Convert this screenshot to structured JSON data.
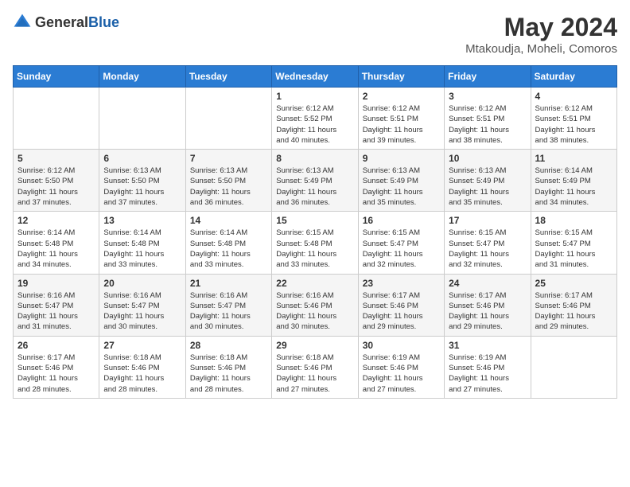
{
  "header": {
    "logo_general": "General",
    "logo_blue": "Blue",
    "month_year": "May 2024",
    "location": "Mtakoudja, Moheli, Comoros"
  },
  "weekdays": [
    "Sunday",
    "Monday",
    "Tuesday",
    "Wednesday",
    "Thursday",
    "Friday",
    "Saturday"
  ],
  "weeks": [
    [
      {
        "day": "",
        "info": ""
      },
      {
        "day": "",
        "info": ""
      },
      {
        "day": "",
        "info": ""
      },
      {
        "day": "1",
        "info": "Sunrise: 6:12 AM\nSunset: 5:52 PM\nDaylight: 11 hours\nand 40 minutes."
      },
      {
        "day": "2",
        "info": "Sunrise: 6:12 AM\nSunset: 5:51 PM\nDaylight: 11 hours\nand 39 minutes."
      },
      {
        "day": "3",
        "info": "Sunrise: 6:12 AM\nSunset: 5:51 PM\nDaylight: 11 hours\nand 38 minutes."
      },
      {
        "day": "4",
        "info": "Sunrise: 6:12 AM\nSunset: 5:51 PM\nDaylight: 11 hours\nand 38 minutes."
      }
    ],
    [
      {
        "day": "5",
        "info": "Sunrise: 6:12 AM\nSunset: 5:50 PM\nDaylight: 11 hours\nand 37 minutes."
      },
      {
        "day": "6",
        "info": "Sunrise: 6:13 AM\nSunset: 5:50 PM\nDaylight: 11 hours\nand 37 minutes."
      },
      {
        "day": "7",
        "info": "Sunrise: 6:13 AM\nSunset: 5:50 PM\nDaylight: 11 hours\nand 36 minutes."
      },
      {
        "day": "8",
        "info": "Sunrise: 6:13 AM\nSunset: 5:49 PM\nDaylight: 11 hours\nand 36 minutes."
      },
      {
        "day": "9",
        "info": "Sunrise: 6:13 AM\nSunset: 5:49 PM\nDaylight: 11 hours\nand 35 minutes."
      },
      {
        "day": "10",
        "info": "Sunrise: 6:13 AM\nSunset: 5:49 PM\nDaylight: 11 hours\nand 35 minutes."
      },
      {
        "day": "11",
        "info": "Sunrise: 6:14 AM\nSunset: 5:49 PM\nDaylight: 11 hours\nand 34 minutes."
      }
    ],
    [
      {
        "day": "12",
        "info": "Sunrise: 6:14 AM\nSunset: 5:48 PM\nDaylight: 11 hours\nand 34 minutes."
      },
      {
        "day": "13",
        "info": "Sunrise: 6:14 AM\nSunset: 5:48 PM\nDaylight: 11 hours\nand 33 minutes."
      },
      {
        "day": "14",
        "info": "Sunrise: 6:14 AM\nSunset: 5:48 PM\nDaylight: 11 hours\nand 33 minutes."
      },
      {
        "day": "15",
        "info": "Sunrise: 6:15 AM\nSunset: 5:48 PM\nDaylight: 11 hours\nand 33 minutes."
      },
      {
        "day": "16",
        "info": "Sunrise: 6:15 AM\nSunset: 5:47 PM\nDaylight: 11 hours\nand 32 minutes."
      },
      {
        "day": "17",
        "info": "Sunrise: 6:15 AM\nSunset: 5:47 PM\nDaylight: 11 hours\nand 32 minutes."
      },
      {
        "day": "18",
        "info": "Sunrise: 6:15 AM\nSunset: 5:47 PM\nDaylight: 11 hours\nand 31 minutes."
      }
    ],
    [
      {
        "day": "19",
        "info": "Sunrise: 6:16 AM\nSunset: 5:47 PM\nDaylight: 11 hours\nand 31 minutes."
      },
      {
        "day": "20",
        "info": "Sunrise: 6:16 AM\nSunset: 5:47 PM\nDaylight: 11 hours\nand 30 minutes."
      },
      {
        "day": "21",
        "info": "Sunrise: 6:16 AM\nSunset: 5:47 PM\nDaylight: 11 hours\nand 30 minutes."
      },
      {
        "day": "22",
        "info": "Sunrise: 6:16 AM\nSunset: 5:46 PM\nDaylight: 11 hours\nand 30 minutes."
      },
      {
        "day": "23",
        "info": "Sunrise: 6:17 AM\nSunset: 5:46 PM\nDaylight: 11 hours\nand 29 minutes."
      },
      {
        "day": "24",
        "info": "Sunrise: 6:17 AM\nSunset: 5:46 PM\nDaylight: 11 hours\nand 29 minutes."
      },
      {
        "day": "25",
        "info": "Sunrise: 6:17 AM\nSunset: 5:46 PM\nDaylight: 11 hours\nand 29 minutes."
      }
    ],
    [
      {
        "day": "26",
        "info": "Sunrise: 6:17 AM\nSunset: 5:46 PM\nDaylight: 11 hours\nand 28 minutes."
      },
      {
        "day": "27",
        "info": "Sunrise: 6:18 AM\nSunset: 5:46 PM\nDaylight: 11 hours\nand 28 minutes."
      },
      {
        "day": "28",
        "info": "Sunrise: 6:18 AM\nSunset: 5:46 PM\nDaylight: 11 hours\nand 28 minutes."
      },
      {
        "day": "29",
        "info": "Sunrise: 6:18 AM\nSunset: 5:46 PM\nDaylight: 11 hours\nand 27 minutes."
      },
      {
        "day": "30",
        "info": "Sunrise: 6:19 AM\nSunset: 5:46 PM\nDaylight: 11 hours\nand 27 minutes."
      },
      {
        "day": "31",
        "info": "Sunrise: 6:19 AM\nSunset: 5:46 PM\nDaylight: 11 hours\nand 27 minutes."
      },
      {
        "day": "",
        "info": ""
      }
    ]
  ]
}
